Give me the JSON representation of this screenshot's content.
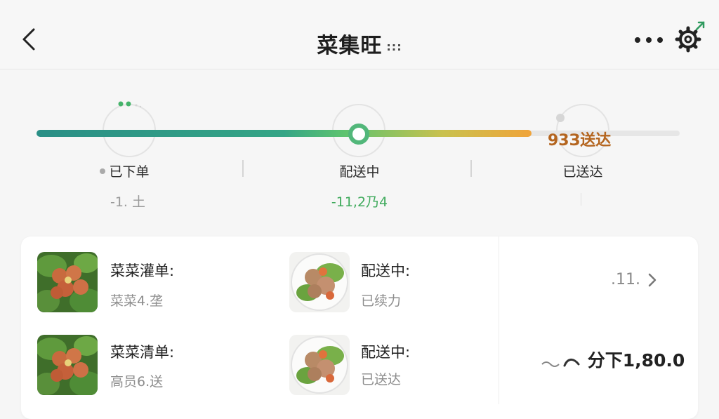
{
  "header": {
    "title": "菜集旺",
    "title_suffix": ":::",
    "back_icon": "chevron-left-icon",
    "more_icon": "more-dots-icon",
    "settings_icon": "gear-icon"
  },
  "progress": {
    "eta_text": "93З送达",
    "fill_fraction": 0.77,
    "steps": [
      {
        "label": "已下单",
        "sub": "-1. 土",
        "state": "done"
      },
      {
        "label": "配送中",
        "sub": "-11,2乃4",
        "state": "current"
      },
      {
        "label": "已送达",
        "sub": "",
        "state": "pending"
      }
    ],
    "colors": {
      "start": "#2a8f86",
      "current": "#52b77a",
      "end": "#f0a43a",
      "eta": "#b4651f"
    }
  },
  "order": {
    "items": [
      {
        "name": "菜菜灌单:",
        "sub": "菜菜4.垄"
      },
      {
        "name": "配送中:",
        "sub": "已续力"
      },
      {
        "name": "菜菜清单:",
        "sub": "高员6.送"
      },
      {
        "name": "配送中:",
        "sub": "已送达"
      }
    ],
    "detail_link": ".11.",
    "total_label": "分下1,80.0"
  }
}
